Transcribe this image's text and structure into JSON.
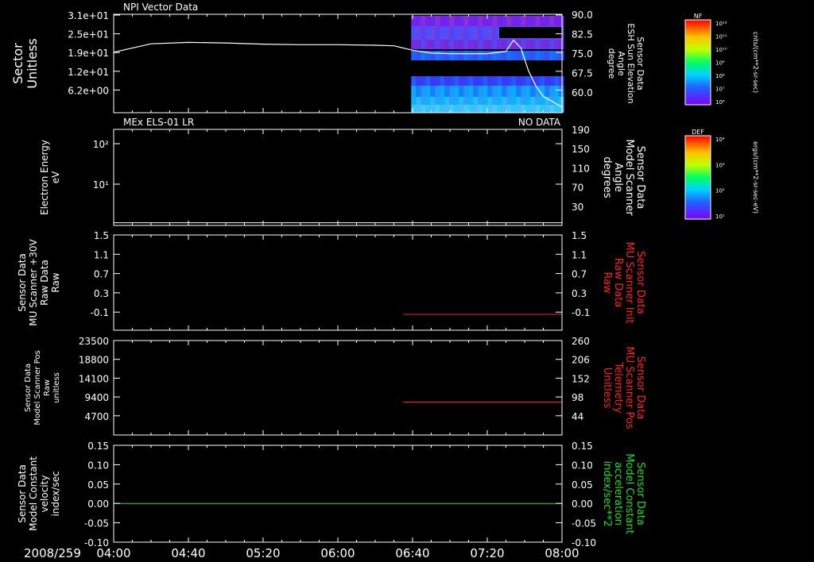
{
  "date": "2008/259",
  "x_ticks": [
    "04:00",
    "04:40",
    "05:20",
    "06:00",
    "06:40",
    "07:20",
    "08:00"
  ],
  "panels": [
    {
      "title_left": "NPI Vector Data",
      "title_right": "",
      "ylabel_left": [
        "Sector",
        "Unitless"
      ],
      "ylabel_right": [
        "Sensor Data",
        "ESH Sun Elevation",
        "Angle",
        "degree"
      ],
      "ylabel_right_color": "#ffffff",
      "left_ticks": [
        "3.1e+01",
        "2.5e+01",
        "1.9e+01",
        "1.2e+01",
        "6.2e+00"
      ],
      "right_ticks": [
        "90.0",
        "82.5",
        "75.0",
        "67.5",
        "60.0"
      ],
      "colorbar": {
        "label": "NF",
        "unit": "cnts/(cm**2-sr-sec)",
        "ticks": [
          "10¹²",
          "10¹¹",
          "10¹⁰",
          "10⁹",
          "10⁸",
          "10⁷",
          "10⁶"
        ]
      }
    },
    {
      "title_left": "MEx ELS-01 LR",
      "title_right": "NO DATA",
      "ylabel_left": [
        "Electron Energy",
        "eV"
      ],
      "ylabel_right": [
        "Sensor Data",
        "Model Scanner",
        "Angle",
        "degrees"
      ],
      "ylabel_right_color": "#ffffff",
      "left_ticks": [
        "10²",
        "10¹"
      ],
      "right_ticks": [
        "190",
        "150",
        "110",
        "70",
        "30"
      ],
      "colorbar": {
        "label": "DEF",
        "unit": "ergs/(cm**2-sr-sec-eV)",
        "ticks": [
          "10⁴",
          "10³",
          "10²",
          "10¹"
        ]
      }
    },
    {
      "title_left": "",
      "title_right": "",
      "ylabel_left": [
        "Sensor Data",
        "MU Scanner +30V",
        "Raw Data",
        "Raw"
      ],
      "ylabel_right": [
        "Sensor Data",
        "MU Scanner Init",
        "Raw Data",
        "Raw"
      ],
      "ylabel_right_color": "#ff2020",
      "left_ticks": [
        "1.5",
        "1.1",
        "0.7",
        "0.3",
        "-0.1"
      ],
      "right_ticks": [
        "1.5",
        "1.1",
        "0.7",
        "0.3",
        "-0.1"
      ]
    },
    {
      "title_left": "",
      "title_right": "",
      "ylabel_left": [
        "Sensor Data",
        "Model Scanner Pos",
        "Raw",
        "unitless"
      ],
      "ylabel_right": [
        "Sensor Data",
        "MU Scanner Pos",
        "Telemetry",
        "Unitless"
      ],
      "ylabel_right_color": "#ff2020",
      "left_ticks": [
        "23500",
        "18800",
        "14100",
        "9400",
        "4700"
      ],
      "right_ticks": [
        "260",
        "206",
        "152",
        "98",
        "44"
      ]
    },
    {
      "title_left": "",
      "title_right": "",
      "ylabel_left": [
        "Sensor Data",
        "Model Constant",
        "velocity",
        "index/sec"
      ],
      "ylabel_right": [
        "Sensor Data",
        "Model Constant",
        "acceleration",
        "index/sec**2"
      ],
      "ylabel_right_color": "#22dd22",
      "left_ticks": [
        "0.15",
        "0.10",
        "0.05",
        "0.00",
        "-0.05",
        "-0.10"
      ],
      "right_ticks": [
        "0.15",
        "0.10",
        "0.05",
        "0.00",
        "-0.05",
        "-0.10"
      ]
    }
  ],
  "chart_data": [
    {
      "type": "heatmap",
      "title": "NPI Vector Data",
      "x_range": [
        "04:00",
        "08:00"
      ],
      "ylabel": "Sector Unitless",
      "ylim": [
        0,
        31
      ],
      "data_start": "06:35",
      "line_series": {
        "name": "Sensor Data ESH Sun Elevation Angle",
        "units": "degree",
        "ylim": [
          55,
          90
        ],
        "x": [
          "04:00",
          "04:20",
          "04:40",
          "05:00",
          "05:20",
          "05:40",
          "06:00",
          "06:20",
          "06:30",
          "06:40",
          "06:50",
          "07:00",
          "07:20",
          "07:30",
          "07:34",
          "07:38",
          "07:42",
          "07:46",
          "07:50",
          "08:00"
        ],
        "y": [
          76.5,
          79.5,
          80.0,
          79.8,
          79.4,
          79.2,
          79.2,
          79.0,
          78.8,
          77.2,
          76.2,
          76.0,
          76.0,
          76.8,
          80.8,
          78.0,
          70.0,
          64.5,
          60.8,
          57.0
        ],
        "color": "#ffffff"
      }
    },
    {
      "type": "line",
      "title": "MEx ELS-01 LR",
      "status": "NO DATA",
      "ylabel": "Electron Energy eV",
      "yscale": "log",
      "right_axis": {
        "label": "Sensor Data Model Scanner Angle degrees",
        "ylim": [
          10,
          190
        ]
      },
      "series": [
        {
          "name": "Sensor Data Model Scanner Angle",
          "x": [
            "04:00",
            "08:00"
          ],
          "y": [
            15,
            15
          ],
          "color": "#ffffff"
        }
      ]
    },
    {
      "type": "line",
      "ylim": [
        -0.3,
        1.5
      ],
      "series": [
        {
          "name": "Sensor Data MU Scanner Init Raw Data",
          "x": [
            "06:35",
            "08:00"
          ],
          "y": [
            0.0,
            0.0
          ],
          "color": "#ff2020"
        }
      ]
    },
    {
      "type": "line",
      "ylim": [
        0,
        23500
      ],
      "right_ylim": [
        -10,
        260
      ],
      "series": [
        {
          "name": "Sensor Data MU Scanner Pos Telemetry",
          "x": [
            "06:35",
            "08:00"
          ],
          "y": [
            8200,
            8200
          ],
          "color": "#ff2020"
        }
      ]
    },
    {
      "type": "line",
      "ylim": [
        -0.1,
        0.15
      ],
      "series": [
        {
          "name": "Sensor Data Model Constant velocity",
          "x": [
            "04:00",
            "08:00"
          ],
          "y": [
            0.0,
            0.0
          ],
          "color": "#22dd22"
        }
      ]
    }
  ]
}
